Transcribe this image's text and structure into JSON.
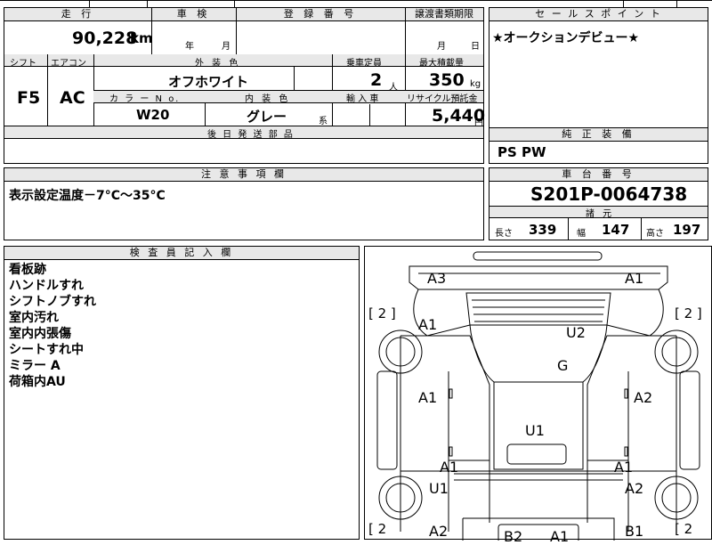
{
  "spec": {
    "headers": {
      "mileage": "走 行",
      "inspection": "車 検",
      "reg_no": "登 録 番 号",
      "transfer_deadline": "譲渡書類期限",
      "shift": "シフト",
      "aircon": "エアコン",
      "exterior_color": "外 装 色",
      "capacity": "乗車定員",
      "max_load": "最大積載量",
      "color_no": "カ ラ ー N o.",
      "interior_color": "内 装 色",
      "import": "輸 入 車",
      "recycle_fee": "リサイクル預託金",
      "later_parts": "後 日 発 送 部 品"
    },
    "values": {
      "mileage": "90,228",
      "mileage_unit": "km",
      "inspection_year": "年",
      "inspection_month": "月",
      "deadline_month": "月",
      "deadline_day": "日",
      "shift": "F5",
      "aircon": "AC",
      "exterior_color": "オフホワイト",
      "capacity": "2",
      "capacity_unit": "人",
      "max_load": "350",
      "max_load_unit": "kg",
      "color_no": "W20",
      "interior_color": "グレー",
      "interior_suffix": "系",
      "recycle_fee": "5,440",
      "recycle_unit": "円"
    }
  },
  "sales": {
    "header": "セ ー ル ス ポ イ ン ト",
    "text": "★オークションデビュー★"
  },
  "equipment": {
    "header": "純 正 装 備",
    "text": "PS PW"
  },
  "notes": {
    "header": "注 意 事 項 欄",
    "text": "表示設定温度－7°C～35°C"
  },
  "chassis": {
    "header": "車 台 番 号",
    "number": "S201P-0064738",
    "dims_header": "諸 元",
    "length_label": "長さ",
    "length": "339",
    "width_label": "幅",
    "width": "147",
    "height_label": "高さ",
    "height": "197"
  },
  "inspector": {
    "header": "検 査 員 記 入 欄",
    "lines": [
      "看板跡",
      "ハンドルすれ",
      "シフトノブすれ",
      "室内汚れ",
      "室内内張傷",
      "シートすれ中",
      "ミラー A",
      "荷箱内AU"
    ]
  },
  "diagram": {
    "labels": {
      "a3": "A3",
      "a1_tr": "A1",
      "a1_l1": "A1",
      "u2": "U2",
      "g": "G",
      "a1_l2": "A1",
      "a2_r1": "A2",
      "u1_c": "U1",
      "a1_l3": "A1",
      "a1_r3": "A1",
      "u1_l": "U1",
      "a2_r2": "A2",
      "a2_bl": "A2",
      "b2": "B2",
      "a1_b": "A1",
      "b1": "B1"
    },
    "tire_left_top": "[ 2 ]",
    "tire_right_top": "[ 2 ]",
    "tire_left_bottom": "[ 2",
    "tire_right_bottom": "[ 2"
  }
}
